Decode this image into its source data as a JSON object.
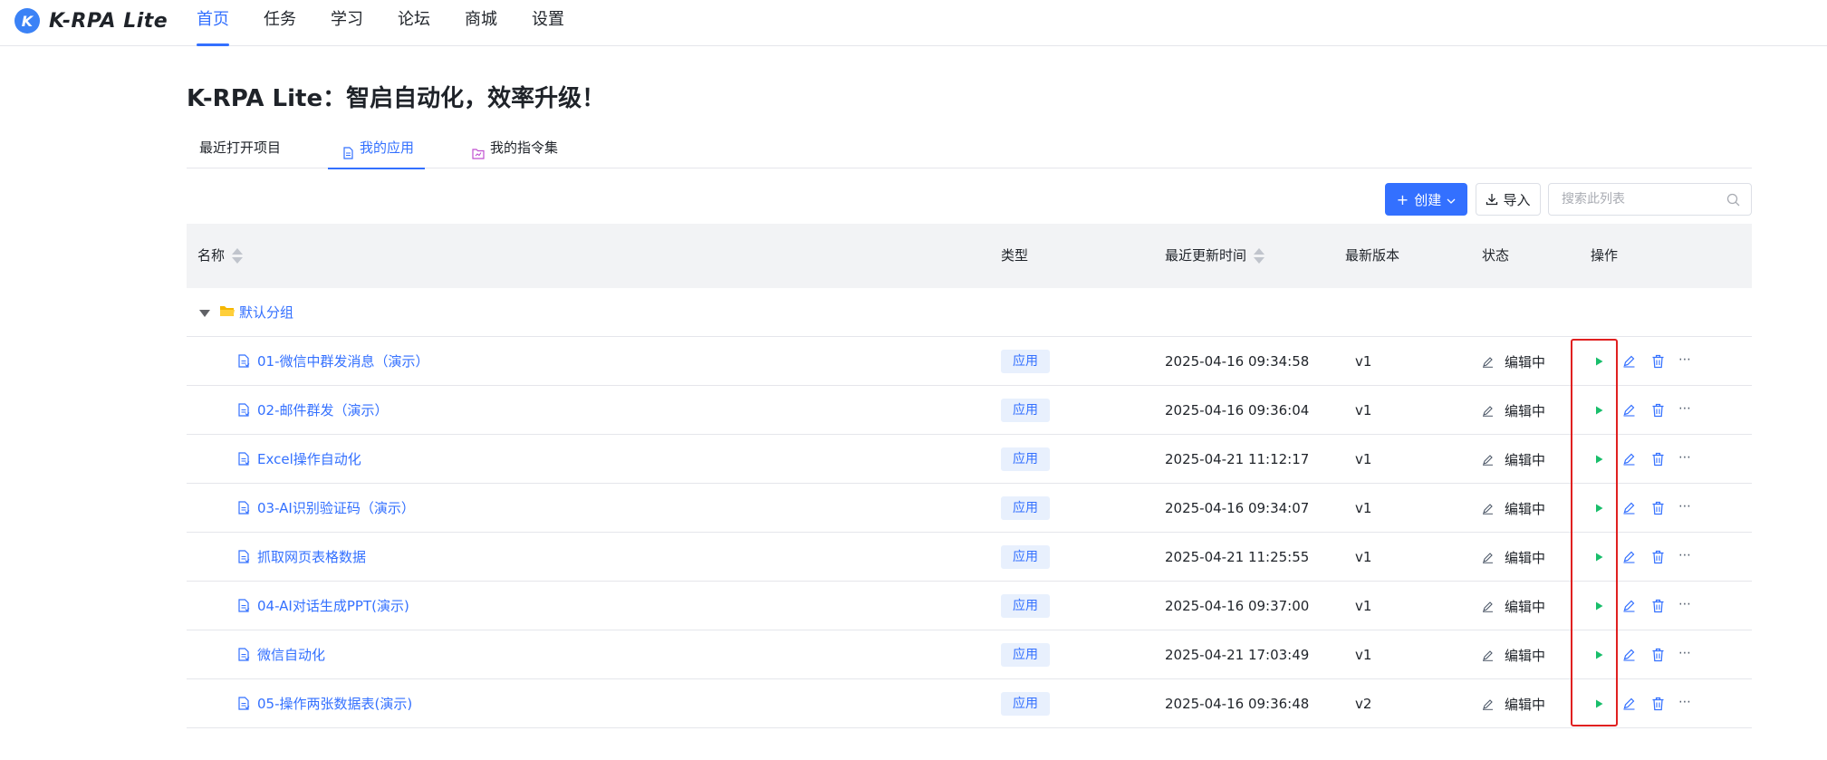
{
  "app": {
    "logo_letter": "K",
    "name": "K-RPA Lite"
  },
  "nav": [
    {
      "label": "首页",
      "active": true
    },
    {
      "label": "任务"
    },
    {
      "label": "学习"
    },
    {
      "label": "论坛"
    },
    {
      "label": "商城"
    },
    {
      "label": "设置"
    }
  ],
  "page_title": "K-RPA Lite：智启自动化，效率升级！",
  "tabs": [
    {
      "label": "最近打开项目"
    },
    {
      "label": "我的应用",
      "active": true
    },
    {
      "label": "我的指令集"
    }
  ],
  "toolbar": {
    "create_label": "创建",
    "import_label": "导入",
    "search_placeholder": "搜索此列表"
  },
  "table": {
    "headers": {
      "name": "名称",
      "type": "类型",
      "updated": "最近更新时间",
      "version": "最新版本",
      "status": "状态",
      "actions": "操作"
    },
    "group": {
      "name": "默认分组"
    },
    "rows": [
      {
        "name": "01-微信中群发消息（演示）",
        "type": "应用",
        "updated": "2025-04-16 09:34:58",
        "version": "v1",
        "status": "编辑中"
      },
      {
        "name": "02-邮件群发（演示）",
        "type": "应用",
        "updated": "2025-04-16 09:36:04",
        "version": "v1",
        "status": "编辑中"
      },
      {
        "name": "Excel操作自动化",
        "type": "应用",
        "updated": "2025-04-21 11:12:17",
        "version": "v1",
        "status": "编辑中"
      },
      {
        "name": "03-AI识别验证码（演示）",
        "type": "应用",
        "updated": "2025-04-16 09:34:07",
        "version": "v1",
        "status": "编辑中"
      },
      {
        "name": "抓取网页表格数据",
        "type": "应用",
        "updated": "2025-04-21 11:25:55",
        "version": "v1",
        "status": "编辑中"
      },
      {
        "name": "04-AI对话生成PPT(演示)",
        "type": "应用",
        "updated": "2025-04-16 09:37:00",
        "version": "v1",
        "status": "编辑中"
      },
      {
        "name": "微信自动化",
        "type": "应用",
        "updated": "2025-04-21 17:03:49",
        "version": "v1",
        "status": "编辑中"
      },
      {
        "name": "05-操作两张数据表(演示)",
        "type": "应用",
        "updated": "2025-04-16 09:36:48",
        "version": "v2",
        "status": "编辑中"
      }
    ]
  },
  "colors": {
    "accent": "#3370ff",
    "run_icon": "#19be6b",
    "folder_icon": "#f5b700",
    "highlight_box": "#e02020",
    "tag_bg": "#e8f0fd"
  },
  "icons": {
    "run": "play-icon",
    "edit": "pencil-icon",
    "delete": "trash-icon",
    "more": "more-icon",
    "file": "file-icon",
    "folder": "folder-icon",
    "search": "search-icon",
    "import": "download-icon"
  }
}
